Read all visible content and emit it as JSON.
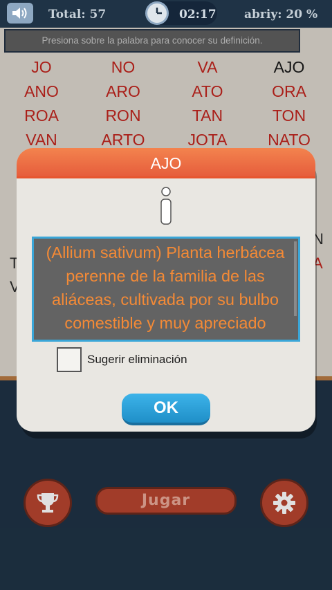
{
  "topbar": {
    "sound_icon": "speaker-icon",
    "total": "Total: 57",
    "clock_icon": "clock-icon",
    "time": "02:17",
    "abriy": "abriy: 20 %"
  },
  "hint": "Presiona sobre la palabra para conocer su definición.",
  "words": [
    [
      "JO",
      "NO",
      "VA",
      "AJO"
    ],
    [
      "ANO",
      "ARO",
      "ATO",
      "ORA"
    ],
    [
      "ROA",
      "RON",
      "TAN",
      "TON"
    ],
    [
      "VAN",
      "ARTO",
      "JOTA",
      "NATO"
    ]
  ],
  "found_words": [
    "AJO"
  ],
  "edge_fragments": {
    "right_n": "N",
    "left_t": "T",
    "right_a": "A",
    "left_v": "V"
  },
  "dialog": {
    "title": "AJO",
    "info_icon": "info-icon",
    "definition": "(Allium sativum) Planta herbácea perenne de la familia de las aliáceas, cultivada por su bulbo comestible y muy apreciado",
    "suggest_label": "Sugerir eliminación",
    "suggest_checked": false,
    "ok_label": "OK"
  },
  "bottom": {
    "trophy_icon": "trophy-icon",
    "play_label": "Jugar",
    "settings_icon": "gear-icon"
  },
  "colors": {
    "word_red": "#c2241d",
    "header_orange": "#ee6f43",
    "definition_orange": "#f48a36",
    "ok_blue": "#2aa0d8",
    "dark_navy": "#1f3346"
  }
}
